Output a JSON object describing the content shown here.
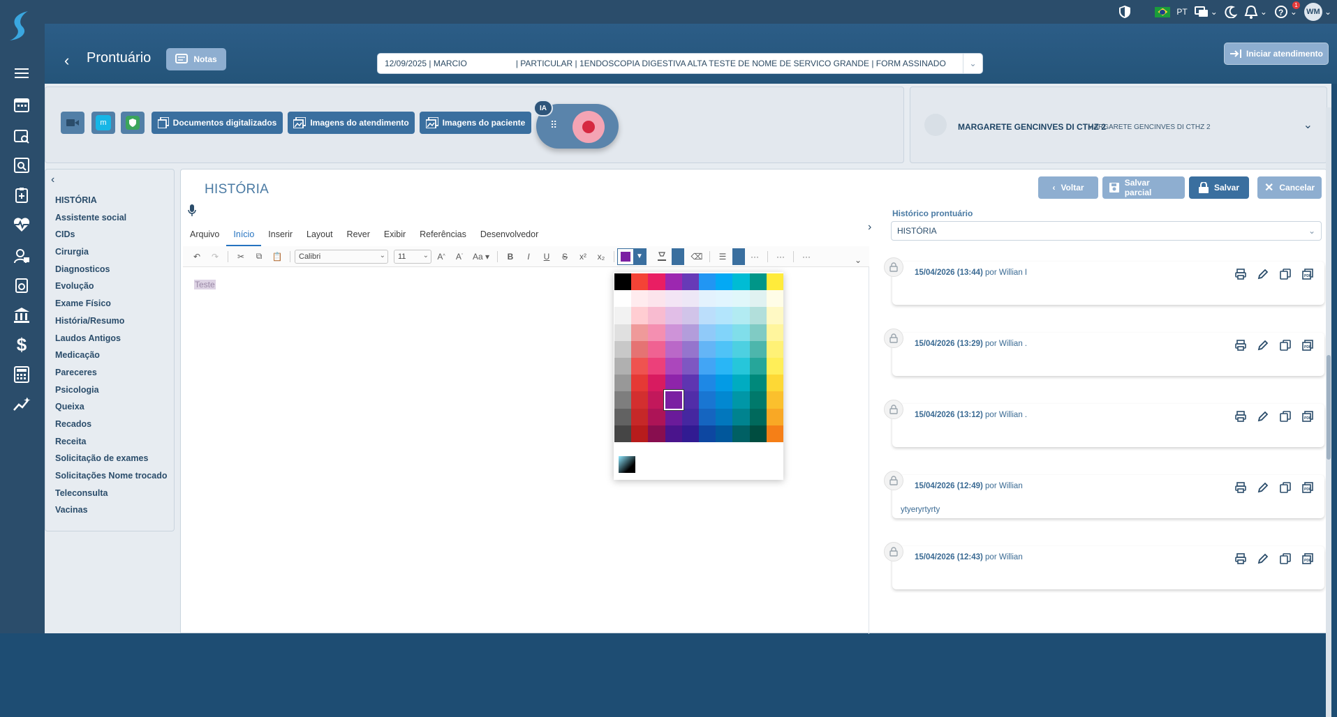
{
  "topbar": {
    "language": "PT",
    "user_initials": "WM",
    "notification_count": "1"
  },
  "header": {
    "title": "Prontuário",
    "notes_label": "Notas",
    "appointment_value": "12/09/2025 | MARCIO                     | PARTICULAR | 1ENDOSCOPIA DIGESTIVA ALTA TESTE DE NOME DE SERVICO GRANDE | FORM ASSINADO",
    "start_label": "Iniciar atendimento"
  },
  "toolpanel": {
    "digitized_docs": "Documentos digitalizados",
    "appointment_images": "Imagens do atendimento",
    "patient_images": "Imagens do paciente",
    "ia_label": "IA"
  },
  "patient": {
    "name": "MARGARETE GENCINVES DI CTHZ 2",
    "social_name": "MARGARETE GENCINVES DI CTHZ 2"
  },
  "sidebar": {
    "items": [
      "HISTÓRIA",
      "Assistente social",
      "CIDs",
      "Cirurgia",
      "Diagnosticos",
      "Evolução",
      "Exame Físico",
      "História/Resumo",
      "Laudos Antigos",
      "Medicação",
      "Pareceres",
      "Psicologia",
      "Queixa",
      "Recados",
      "Receita",
      "Solicitação de exames",
      "Solicitações Nome trocado",
      "Teleconsulta",
      "Vacinas"
    ]
  },
  "content": {
    "title": "HISTÓRIA",
    "back_label": "Voltar",
    "save_partial_label": "Salvar parcial",
    "save_label": "Salvar",
    "cancel_label": "Cancelar"
  },
  "editor": {
    "menus": [
      "Arquivo",
      "Início",
      "Inserir",
      "Layout",
      "Rever",
      "Exibir",
      "Referências",
      "Desenvolvedor"
    ],
    "active_menu": "Início",
    "font_family": "Calibri",
    "font_size": "11",
    "document_text": "Teste",
    "selected_font_color": "#7b1fa2"
  },
  "palette": {
    "colors": [
      [
        "#000000",
        "#f44336",
        "#e91e63",
        "#9c27b0",
        "#673ab7",
        "#2196f3",
        "#03a9f4",
        "#00bcd4",
        "#009688",
        "#ffeb3b"
      ],
      [
        "#ffffff",
        "#ffebee",
        "#fce4ec",
        "#f3e5f5",
        "#ede7f6",
        "#e3f2fd",
        "#e1f5fe",
        "#e0f7fa",
        "#e0f2f1",
        "#fffde7"
      ],
      [
        "#f2f2f2",
        "#ffcdd2",
        "#f8bbd0",
        "#e1bee7",
        "#d1c4e9",
        "#bbdefb",
        "#b3e5fc",
        "#b2ebf2",
        "#b2dfdb",
        "#fff9c4"
      ],
      [
        "#e0e0e0",
        "#ef9a9a",
        "#f48fb1",
        "#ce93d8",
        "#b39ddb",
        "#90caf9",
        "#81d4fa",
        "#80deea",
        "#80cbc4",
        "#fff59d"
      ],
      [
        "#c8c8c8",
        "#e57373",
        "#f06292",
        "#ba68c8",
        "#9575cd",
        "#64b5f6",
        "#4fc3f7",
        "#4dd0e1",
        "#4db6ac",
        "#fff176"
      ],
      [
        "#b0b0b0",
        "#ef5350",
        "#ec407a",
        "#ab47bc",
        "#7e57c2",
        "#42a5f5",
        "#29b6f6",
        "#26c6da",
        "#26a69a",
        "#ffee58"
      ],
      [
        "#989898",
        "#e53935",
        "#d81b60",
        "#8e24aa",
        "#5e35b1",
        "#1e88e5",
        "#039be5",
        "#00acc1",
        "#00897b",
        "#fdd835"
      ],
      [
        "#7e7e7e",
        "#d32f2f",
        "#c2185b",
        "#7b1fa2",
        "#512da8",
        "#1976d2",
        "#0288d1",
        "#0097a7",
        "#00796b",
        "#fbc02d"
      ],
      [
        "#626262",
        "#c62828",
        "#ad1457",
        "#6a1b9a",
        "#4527a0",
        "#1565c0",
        "#0277bd",
        "#00838f",
        "#00695c",
        "#f9a825"
      ],
      [
        "#454545",
        "#b71c1c",
        "#880e4f",
        "#4a148c",
        "#311b92",
        "#0d47a1",
        "#01579b",
        "#006064",
        "#004d40",
        "#f57f17"
      ]
    ],
    "selected": "7-3"
  },
  "history": {
    "label": "Histórico prontuário",
    "select_value": "HISTÓRIA",
    "entries": [
      {
        "date": "15/04/2026 (13:44)",
        "by": "por Willian I",
        "text": ""
      },
      {
        "date": "15/04/2026 (13:29)",
        "by": "por Willian .",
        "text": ""
      },
      {
        "date": "15/04/2026 (13:12)",
        "by": "por Willian .",
        "text": ""
      },
      {
        "date": "15/04/2026 (12:49)",
        "by": "por Willian",
        "text": "ytyeryrtyrty"
      },
      {
        "date": "15/04/2026 (12:43)",
        "by": "por Willian",
        "text": ""
      }
    ]
  }
}
